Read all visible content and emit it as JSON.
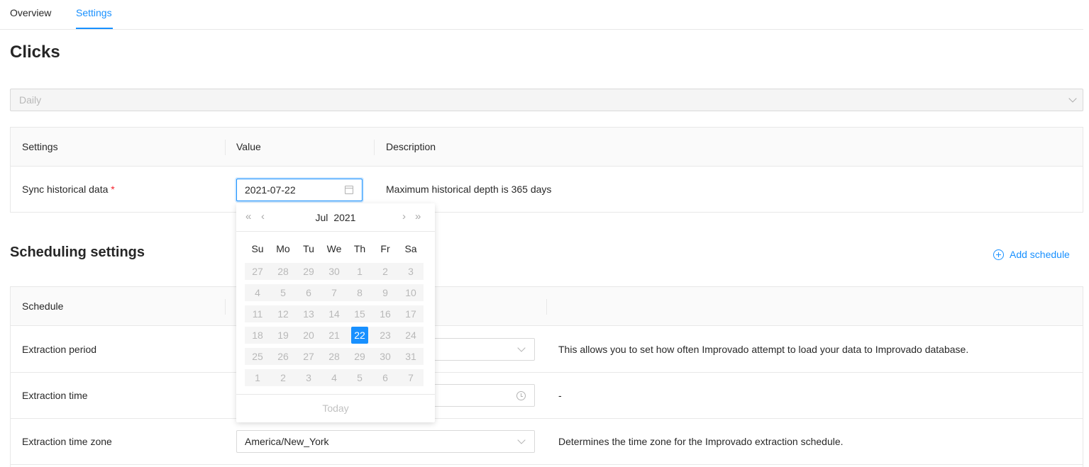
{
  "tabs": [
    {
      "label": "Overview"
    },
    {
      "label": "Settings"
    }
  ],
  "page_title": "Clicks",
  "frequency_select": {
    "value": "Daily"
  },
  "settings_table": {
    "headers": [
      "Settings",
      "Value",
      "Description"
    ],
    "rows": [
      {
        "setting": "Sync historical data",
        "required_mark": "*",
        "value": "2021-07-22",
        "description": "Maximum historical depth is 365 days"
      }
    ]
  },
  "date_picker": {
    "month": "Jul",
    "year": "2021",
    "prev_year_icon": "«",
    "prev_month_icon": "‹",
    "next_month_icon": "›",
    "next_year_icon": "»",
    "weekdays": [
      "Su",
      "Mo",
      "Tu",
      "We",
      "Th",
      "Fr",
      "Sa"
    ],
    "weeks": [
      [
        "27",
        "28",
        "29",
        "30",
        "1",
        "2",
        "3"
      ],
      [
        "4",
        "5",
        "6",
        "7",
        "8",
        "9",
        "10"
      ],
      [
        "11",
        "12",
        "13",
        "14",
        "15",
        "16",
        "17"
      ],
      [
        "18",
        "19",
        "20",
        "21",
        "22",
        "23",
        "24"
      ],
      [
        "25",
        "26",
        "27",
        "28",
        "29",
        "30",
        "31"
      ],
      [
        "1",
        "2",
        "3",
        "4",
        "5",
        "6",
        "7"
      ]
    ],
    "selected_day": "22",
    "today_label": "Today"
  },
  "scheduling": {
    "title": "Scheduling settings",
    "add_schedule_label": "Add schedule",
    "table_header": "Schedule",
    "rows": [
      {
        "label": "Extraction period",
        "value": "",
        "description": "This allows you to set how often Improvado attempt to load your data to Improvado database."
      },
      {
        "label": "Extraction time",
        "value": "",
        "description": "-"
      },
      {
        "label": "Extraction time zone",
        "value": "America/New_York",
        "description": "Determines the time zone for the Improvado extraction schedule."
      }
    ]
  },
  "colors": {
    "accent": "#1890ff",
    "required": "#f5222d"
  }
}
